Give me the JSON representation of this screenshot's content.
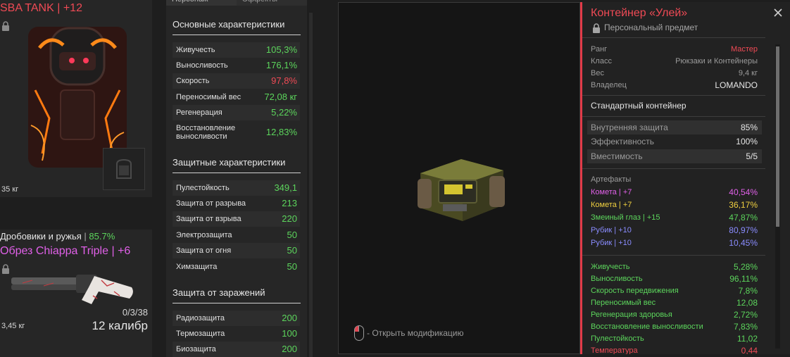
{
  "colors": {
    "accent_red": "#ef4a55",
    "stat_green": "#5cd55c",
    "artifact_pink": "#e060e8",
    "artifact_yellow": "#f0d040",
    "artifact_blue": "#8a8cff",
    "artifact_green": "#5cd55c"
  },
  "armor": {
    "name": "SBA TANK",
    "upgrade": "+12",
    "weight": "35 кг"
  },
  "weapon": {
    "skill_label": "Дробовики и ружья",
    "skill_value": "85.7%",
    "name": "Обрез Chiappa Triple",
    "upgrade": "+6",
    "ammo_count": "0/3/38",
    "weight": "3,45 кг",
    "caliber": "12 калибр"
  },
  "stats": {
    "tabs": [
      "Персонаж",
      "Эффекты"
    ],
    "basic_header": "Основные характеристики",
    "basic": [
      {
        "label": "Живучесть",
        "value": "105,3%",
        "color": "green"
      },
      {
        "label": "Выносливость",
        "value": "176,1%",
        "color": "green"
      },
      {
        "label": "Скорость",
        "value": "97,8%",
        "color": "red"
      },
      {
        "label": "Переносимый вес",
        "value": "72,08 кг",
        "color": "green"
      },
      {
        "label": "Регенерация",
        "value": "5,22%",
        "color": "green"
      },
      {
        "label": "Восстановление выносливости",
        "value": "12,83%",
        "color": "green"
      }
    ],
    "protect_header": "Защитные характеристики",
    "protect": [
      {
        "label": "Пулестойкость",
        "value": "349,1"
      },
      {
        "label": "Защита от разрыва",
        "value": "213"
      },
      {
        "label": "Защита от взрыва",
        "value": "220"
      },
      {
        "label": "Электрозащита",
        "value": "50"
      },
      {
        "label": "Защита от огня",
        "value": "50"
      },
      {
        "label": "Химзащита",
        "value": "50"
      }
    ],
    "contam_header": "Защита от заражений",
    "contam": [
      {
        "label": "Радиозащита",
        "value": "200"
      },
      {
        "label": "Термозащита",
        "value": "100"
      },
      {
        "label": "Биозащита",
        "value": "200"
      }
    ]
  },
  "preview": {
    "mod_hint": "- Открыть модификацию"
  },
  "item": {
    "title": "Контейнер «Улей»",
    "subtitle": "Персональный предмет",
    "meta": [
      {
        "label": "Ранг",
        "value": "Мастер",
        "value_color": "#ef4a55"
      },
      {
        "label": "Класс",
        "value": "Рюкзаки и Контейнеры",
        "value_color": "#9b9b9b"
      },
      {
        "label": "Вес",
        "value": "9,4 кг",
        "value_color": "#9b9b9b"
      },
      {
        "label": "Владелец",
        "value": "LOMANDO",
        "value_color": "#e6e6e6"
      }
    ],
    "type_label": "Стандартный контейнер",
    "bands": [
      {
        "label": "Внутренняя защита",
        "value": "85%"
      },
      {
        "label": "Эффективность",
        "value": "100%"
      },
      {
        "label": "Вместимость",
        "value": "5/5"
      }
    ],
    "artifacts_header": "Артефакты",
    "artifacts": [
      {
        "label": "Комета | +7",
        "value": "40,54%",
        "color": "#e060e8"
      },
      {
        "label": "Комета | +7",
        "value": "36,17%",
        "color": "#f0d040"
      },
      {
        "label": "Змеиный глаз | +15",
        "value": "47,87%",
        "color": "#5cd55c"
      },
      {
        "label": "Рубик | +10",
        "value": "80,97%",
        "color": "#8a8cff"
      },
      {
        "label": "Рубик | +10",
        "value": "10,45%",
        "color": "#8a8cff"
      }
    ],
    "bonuses": [
      {
        "label": "Живучесть",
        "value": "5,28%"
      },
      {
        "label": "Выносливость",
        "value": "96,11%"
      },
      {
        "label": "Скорость передвижения",
        "value": "7,8%"
      },
      {
        "label": "Переносимый вес",
        "value": "12,08"
      },
      {
        "label": "Регенерация здоровья",
        "value": "2,72%"
      },
      {
        "label": "Восстановление выносливости",
        "value": "7,83%"
      },
      {
        "label": "Пулестойкость",
        "value": "11,02"
      },
      {
        "label": "Температура",
        "value": "0,44",
        "color": "#ef4a55"
      }
    ]
  }
}
